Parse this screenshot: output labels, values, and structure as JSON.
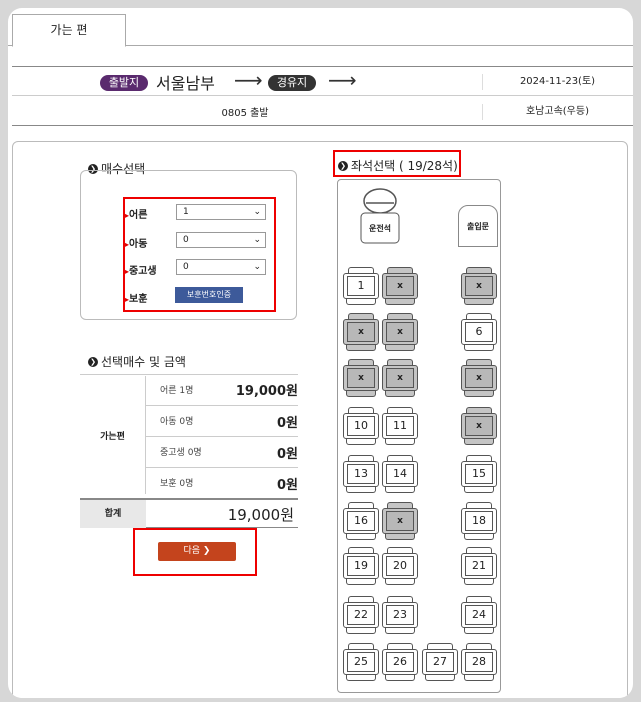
{
  "tab": {
    "label": "가는 편"
  },
  "route": {
    "departure_badge": "출발지",
    "departure_city": "서울남부",
    "via_badge": "경유지",
    "arrow": "⟶",
    "date": "2024-11-23(토)"
  },
  "schedule": {
    "time": "0805 출발",
    "bus_type": "호남고속(우등)"
  },
  "ticket_section": {
    "title": "매수선택",
    "rows": [
      {
        "label": "어른",
        "value": "1"
      },
      {
        "label": "아동",
        "value": "0"
      },
      {
        "label": "중고생",
        "value": "0"
      }
    ],
    "veteran_label": "보훈",
    "veteran_button": "보훈번호인증"
  },
  "price_section": {
    "title": "선택매수 및 금액",
    "trip_label": "가는편",
    "lines": [
      {
        "label": "어른 1명",
        "amount": "19,000원"
      },
      {
        "label": "아동 0명",
        "amount": "0원"
      },
      {
        "label": "중고생 0명",
        "amount": "0원"
      },
      {
        "label": "보훈 0명",
        "amount": "0원"
      }
    ],
    "total_label": "합계",
    "total_amount": "19,000원"
  },
  "next_button": {
    "label": "다음 ❯"
  },
  "seat_section": {
    "title": "좌석선택 ( 19/28석)",
    "driver_label": "운전석",
    "entrance_label": "출입문",
    "taken_mark": "x",
    "seats": [
      {
        "label": "1",
        "taken": false
      },
      {
        "label": "x",
        "taken": true
      },
      {
        "label": "x",
        "taken": true
      },
      {
        "label": "x",
        "taken": true
      },
      {
        "label": "x",
        "taken": true
      },
      {
        "label": "6",
        "taken": false
      },
      {
        "label": "x",
        "taken": true
      },
      {
        "label": "x",
        "taken": true
      },
      {
        "label": "x",
        "taken": true
      },
      {
        "label": "10",
        "taken": false
      },
      {
        "label": "11",
        "taken": false
      },
      {
        "label": "x",
        "taken": true
      },
      {
        "label": "13",
        "taken": false
      },
      {
        "label": "14",
        "taken": false
      },
      {
        "label": "15",
        "taken": false
      },
      {
        "label": "16",
        "taken": false
      },
      {
        "label": "x",
        "taken": true
      },
      {
        "label": "18",
        "taken": false
      },
      {
        "label": "19",
        "taken": false
      },
      {
        "label": "20",
        "taken": false
      },
      {
        "label": "21",
        "taken": false
      },
      {
        "label": "22",
        "taken": false
      },
      {
        "label": "23",
        "taken": false
      },
      {
        "label": "24",
        "taken": false
      },
      {
        "label": "25",
        "taken": false
      },
      {
        "label": "26",
        "taken": false
      },
      {
        "label": "27",
        "taken": false
      },
      {
        "label": "28",
        "taken": false
      }
    ]
  }
}
